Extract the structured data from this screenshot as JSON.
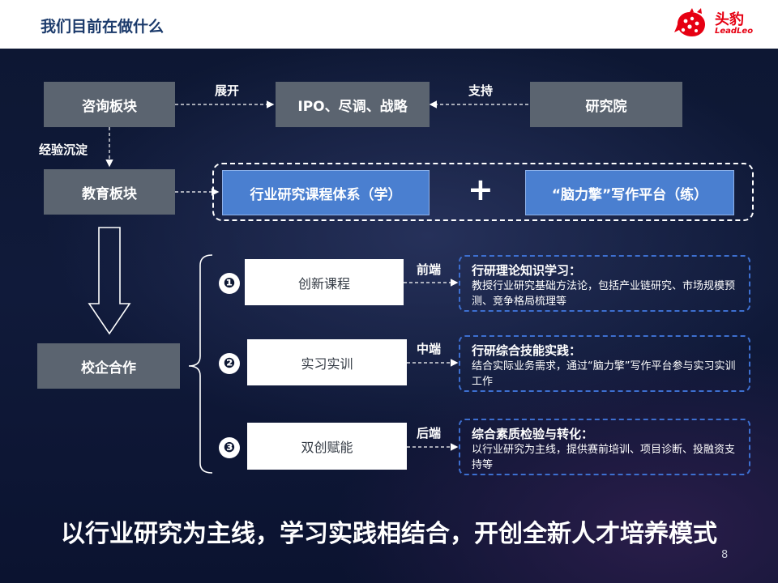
{
  "header": {
    "title": "我们目前在做什么",
    "logo_cn": "头豹",
    "logo_en": "LeadLeo"
  },
  "top_flow": {
    "consult_block": "咨询板块",
    "expand_label": "展开",
    "ipo_box": "IPO、尽调、战略",
    "support_label": "支持",
    "research_institute": "研究院",
    "experience_label": "经验沉淀",
    "education_block": "教育板块",
    "course_system": "行业研究课程体系（学）",
    "plus": "+",
    "writing_platform": "“脑力擎”写作平台（练）"
  },
  "school_enterprise": {
    "label": "校企合作",
    "items": [
      {
        "num": "❶",
        "name": "创新课程",
        "stage": "前端",
        "title": "行研理论知识学习：",
        "desc": "教授行业研究基础方法论，包括产业链研究、市场规模预测、竞争格局梳理等"
      },
      {
        "num": "❷",
        "name": "实习实训",
        "stage": "中端",
        "title": "行研综合技能实践：",
        "desc": "结合实际业务需求，通过“脑力擎”写作平台参与实习实训工作"
      },
      {
        "num": "❸",
        "name": "双创赋能",
        "stage": "后端",
        "title": "综合素质检验与转化：",
        "desc": "以行业研究为主线，提供赛前培训、项目诊断、投融资支持等"
      }
    ]
  },
  "slogan": "以行业研究为主线，学习实践相结合，开创全新人才培养模式",
  "page_number": "8",
  "colors": {
    "title": "#1b3a6b",
    "brand_red": "#e60012",
    "gray_box": "#5b6470",
    "blue_box": "#4a7fd0",
    "panel_border": "#3d6fd0"
  }
}
